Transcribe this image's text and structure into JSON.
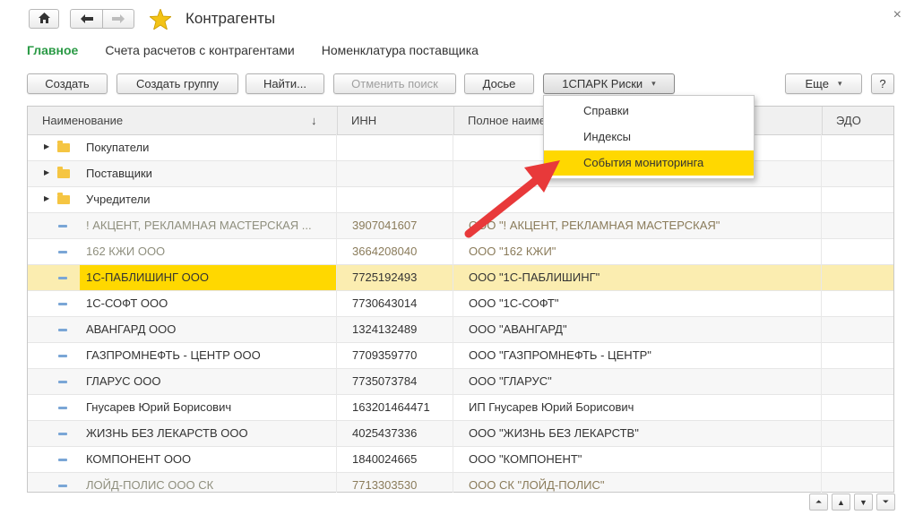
{
  "window": {
    "title": "Контрагенты",
    "close_glyph": "×",
    "home_icon": "home-icon",
    "back_icon": "arrow-left-icon",
    "forward_icon": "arrow-right-icon",
    "star_icon": "star-icon"
  },
  "tabs": [
    {
      "label": "Главное",
      "active": true
    },
    {
      "label": "Счета расчетов с контрагентами",
      "active": false
    },
    {
      "label": "Номенклатура поставщика",
      "active": false
    }
  ],
  "toolbar": {
    "create": "Создать",
    "create_group": "Создать группу",
    "find": "Найти...",
    "cancel_search": "Отменить поиск",
    "dossier": "Досье",
    "spark": "1СПАРК Риски",
    "more": "Еще",
    "help": "?"
  },
  "columns": {
    "name": "Наименование",
    "sort_glyph": "↓",
    "inn": "ИНН",
    "full": "Полное наименование",
    "edo": "ЭДО"
  },
  "groups": [
    {
      "name": "Покупатели"
    },
    {
      "name": "Поставщики"
    },
    {
      "name": "Учредители"
    }
  ],
  "rows": [
    {
      "name": "! АКЦЕНТ, РЕКЛАМНАЯ МАСТЕРСКАЯ ...",
      "inn": "3907041607",
      "full": "ООО \"! АКЦЕНТ, РЕКЛАМНАЯ МАСТЕРСКАЯ\"",
      "greyed": true
    },
    {
      "name": "162 КЖИ ООО",
      "inn": "3664208040",
      "full": "ООО \"162 КЖИ\"",
      "greyed": true
    },
    {
      "name": "1С-ПАБЛИШИНГ ООО",
      "inn": "7725192493",
      "full": "ООО \"1С-ПАБЛИШИНГ\"",
      "selected": true
    },
    {
      "name": "1С-СОФТ ООО",
      "inn": "7730643014",
      "full": "ООО \"1С-СОФТ\""
    },
    {
      "name": "АВАНГАРД ООО",
      "inn": "1324132489",
      "full": "ООО  \"АВАНГАРД\""
    },
    {
      "name": "ГАЗПРОМНЕФТЬ - ЦЕНТР ООО",
      "inn": "7709359770",
      "full": "ООО \"ГАЗПРОМНЕФТЬ - ЦЕНТР\""
    },
    {
      "name": "ГЛАРУС ООО",
      "inn": "7735073784",
      "full": "ООО \"ГЛАРУС\""
    },
    {
      "name": "Гнусарев Юрий Борисович",
      "inn": "163201464471",
      "full": "ИП Гнусарев Юрий Борисович"
    },
    {
      "name": "ЖИЗНЬ БЕЗ ЛЕКАРСТВ ООО",
      "inn": "4025437336",
      "full": "ООО \"ЖИЗНЬ БЕЗ ЛЕКАРСТВ\""
    },
    {
      "name": "КОМПОНЕНТ ООО",
      "inn": "1840024665",
      "full": "ООО \"КОМПОНЕНТ\""
    },
    {
      "name": "ЛОЙД-ПОЛИС ООО СК",
      "inn": "7713303530",
      "full": "ООО СК \"ЛОЙД-ПОЛИС\"",
      "greyed": true
    }
  ],
  "menu": {
    "items": [
      {
        "label": "Справки"
      },
      {
        "label": "Индексы"
      },
      {
        "label": "События мониторинга",
        "highlighted": true
      }
    ]
  },
  "colors": {
    "accent_green": "#2a9a45",
    "highlight_yellow": "#ffd800",
    "selected_row": "#fbedb0",
    "arrow_red": "#e8393a"
  },
  "pager": [
    "⏶",
    "▲",
    "▼",
    "⏷"
  ]
}
